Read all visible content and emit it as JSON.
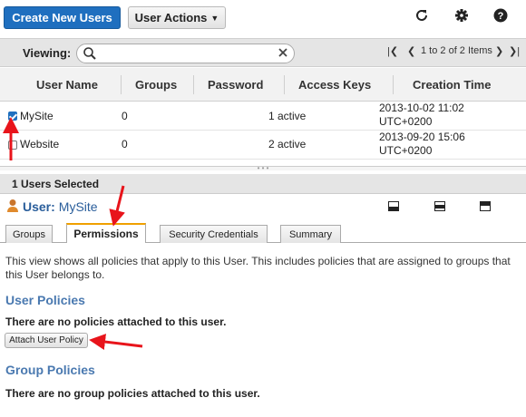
{
  "toolbar": {
    "create_label": "Create New Users",
    "actions_label": "User Actions",
    "icons": [
      "refresh-icon",
      "gear-icon",
      "help-icon"
    ]
  },
  "viewing": {
    "label": "Viewing:",
    "search_value": "",
    "pager_text": "1 to 2 of 2 Items"
  },
  "table": {
    "columns": [
      "User Name",
      "Groups",
      "Password",
      "Access Keys",
      "Creation Time"
    ],
    "rows": [
      {
        "selected": true,
        "name": "MySite",
        "groups": "0",
        "password": "",
        "keys": "1 active",
        "time_line1": "2013-10-02 11:02",
        "time_line2": "UTC+0200"
      },
      {
        "selected": false,
        "name": "Website",
        "groups": "0",
        "password": "",
        "keys": "2 active",
        "time_line1": "2013-09-20 15:06",
        "time_line2": "UTC+0200"
      }
    ]
  },
  "selection": {
    "text": "1 Users Selected"
  },
  "detail": {
    "user_prefix": "User:",
    "user_name": "MySite",
    "tabs": [
      "Groups",
      "Permissions",
      "Security Credentials",
      "Summary"
    ],
    "active_tab": "Permissions",
    "description": "This view shows all policies that apply to this User. This includes policies that are assigned to groups that this User belongs to.",
    "user_policies_title": "User Policies",
    "user_policies_empty": "There are no policies attached to this user.",
    "attach_button": "Attach User Policy",
    "group_policies_title": "Group Policies",
    "group_policies_empty": "There are no group policies attached to this user."
  },
  "colors": {
    "primary": "#1f6fbf",
    "section_title": "#4a79b0",
    "active_tab_accent": "#f0a000",
    "annotation_arrow": "#e8141b"
  }
}
